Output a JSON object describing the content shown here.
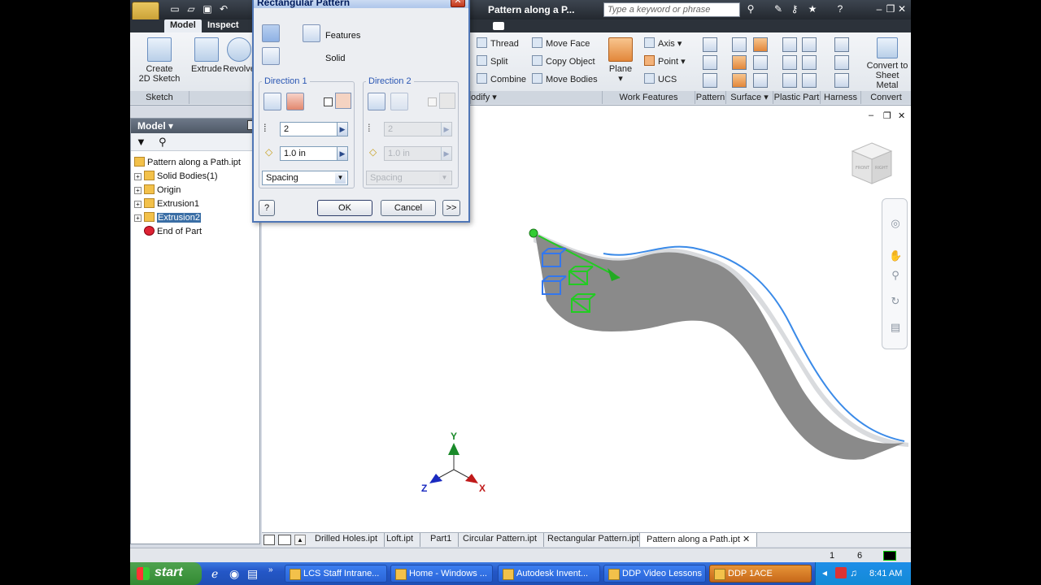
{
  "app": {
    "title": "Pattern along a P...",
    "search_placeholder": "Type a keyword or phrase",
    "tabs": [
      "Model",
      "Inspect"
    ]
  },
  "ribbon": {
    "create_2d_sketch": "Create\n2D Sketch",
    "extrude": "Extrude",
    "revolve": "Revolve",
    "sketch_label": "Sketch",
    "modify_label": "odify",
    "thread": "Thread",
    "split": "Split",
    "combine": "Combine",
    "move_face": "Move Face",
    "copy_object": "Copy Object",
    "move_bodies": "Move Bodies",
    "plane": "Plane",
    "axis": "Axis",
    "point": "Point",
    "ucs": "UCS",
    "work_features_label": "Work Features",
    "pattern_label": "Pattern",
    "surface_label": "Surface",
    "plastic_part_label": "Plastic Part",
    "harness_label": "Harness",
    "convert_label": "Convert",
    "convert_sheet": "Convert to\nSheet Metal"
  },
  "browser": {
    "header": "Model",
    "nodes": [
      {
        "label": "Pattern along a Path.ipt"
      },
      {
        "label": "Solid Bodies(1)"
      },
      {
        "label": "Origin"
      },
      {
        "label": "Extrusion1"
      },
      {
        "label": "Extrusion2"
      },
      {
        "label": "End of Part"
      }
    ]
  },
  "dialog": {
    "title": "Rectangular Pattern",
    "features": "Features",
    "solid": "Solid",
    "direction1": {
      "title": "Direction 1",
      "count": "2",
      "length": "1.0 in",
      "method": "Spacing"
    },
    "direction2": {
      "title": "Direction 2",
      "count": "2",
      "length": "1.0 in",
      "method": "Spacing"
    },
    "ok": "OK",
    "cancel": "Cancel",
    "more": ">>",
    "help": "?"
  },
  "viewport": {
    "axis_x": "X",
    "axis_y": "Y",
    "axis_z": "Z",
    "viewcube_front": "FRONT",
    "viewcube_right": "RIGHT"
  },
  "doctabs": [
    "Drilled Holes.ipt",
    "Loft.ipt",
    "Part1",
    "Circular Pattern.ipt",
    "Rectangular Pattern.ipt",
    "Pattern along a Path.ipt"
  ],
  "status": {
    "left_num": "1",
    "right_num": "6"
  },
  "taskbar": {
    "start": "start",
    "items": [
      "LCS Staff Intrane...",
      "Home - Windows ...",
      "Autodesk Invent...",
      "DDP Video Lessons",
      "DDP 1ACE"
    ],
    "clock": "8:41 AM"
  },
  "colors": {
    "accent": "#3a6ea5",
    "part_gray": "#8a8a8a",
    "pattern_green": "#22cc22",
    "pattern_blue": "#3377ee"
  }
}
